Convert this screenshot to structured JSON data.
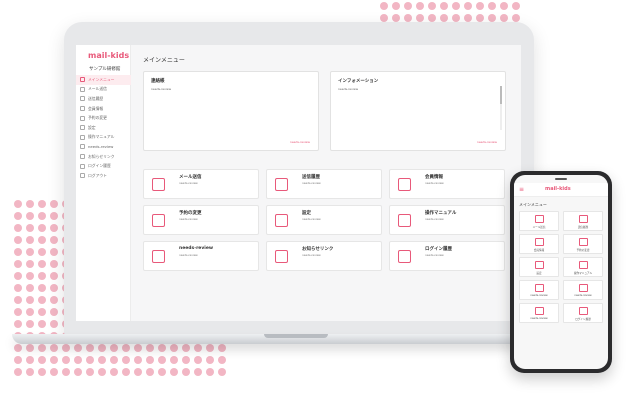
{
  "colors": {
    "accent": "#e8597a",
    "dots": "#f2b6c4"
  },
  "app": {
    "logo": "mail-kids",
    "subtitle": "サンプル研修館",
    "page_title": "メインメニュー"
  },
  "sidebar": {
    "items": [
      {
        "label": "メインメニュー",
        "icon": "home-icon",
        "active": true
      },
      {
        "label": "メール送信",
        "icon": "mail-icon"
      },
      {
        "label": "送信履歴",
        "icon": "history-icon"
      },
      {
        "label": "会員情報",
        "icon": "user-icon"
      },
      {
        "label": "予約の変更",
        "icon": "calendar-icon"
      },
      {
        "label": "設定",
        "icon": "gear-icon"
      },
      {
        "label": "操作マニュアル",
        "icon": "manual-icon"
      },
      {
        "label": "needs-review",
        "icon": "folder-icon"
      },
      {
        "label": "お知らせリンク",
        "icon": "link-icon"
      },
      {
        "label": "ログイン履歴",
        "icon": "login-icon"
      },
      {
        "label": "ログアウト",
        "icon": "logout-icon"
      }
    ]
  },
  "info": {
    "contact": {
      "title": "連絡帳",
      "text": "needs-review",
      "link": "needs-review"
    },
    "information": {
      "title": "インフォメーション",
      "text": "needs-review",
      "link": "needs-review"
    }
  },
  "cards": [
    {
      "title": "メール送信",
      "desc": "needs-review",
      "icon": "mail-icon"
    },
    {
      "title": "送信履歴",
      "desc": "needs-review",
      "icon": "history-icon"
    },
    {
      "title": "会員情報",
      "desc": "needs-review",
      "icon": "user-icon"
    },
    {
      "title": "予約の変更",
      "desc": "needs-review",
      "icon": "calendar-icon"
    },
    {
      "title": "設定",
      "desc": "needs-review",
      "icon": "tools-icon"
    },
    {
      "title": "操作マニュアル",
      "desc": "needs-review",
      "icon": "manual-icon"
    },
    {
      "title": "needs-review",
      "desc": "needs-review",
      "icon": "folder-icon"
    },
    {
      "title": "お知らせリンク",
      "desc": "needs-review",
      "icon": "link-icon"
    },
    {
      "title": "ログイン履歴",
      "desc": "needs-review",
      "icon": "login-icon"
    }
  ],
  "phone": {
    "menu_glyph": "≡",
    "logo": "mail-kids",
    "title": "メインメニュー",
    "items": [
      {
        "label": "メール送信",
        "icon": "mail-icon"
      },
      {
        "label": "送信履歴",
        "icon": "history-icon"
      },
      {
        "label": "会員情報",
        "icon": "user-icon"
      },
      {
        "label": "予約の変更",
        "icon": "calendar-icon"
      },
      {
        "label": "設定",
        "icon": "tools-icon"
      },
      {
        "label": "操作マニュアル",
        "icon": "manual-icon"
      },
      {
        "label": "needs-review",
        "icon": "folder-icon"
      },
      {
        "label": "needs-review",
        "icon": "data-icon"
      },
      {
        "label": "needs-review",
        "icon": "user-icon"
      },
      {
        "label": "ログイン履歴",
        "icon": "login-icon"
      }
    ]
  }
}
